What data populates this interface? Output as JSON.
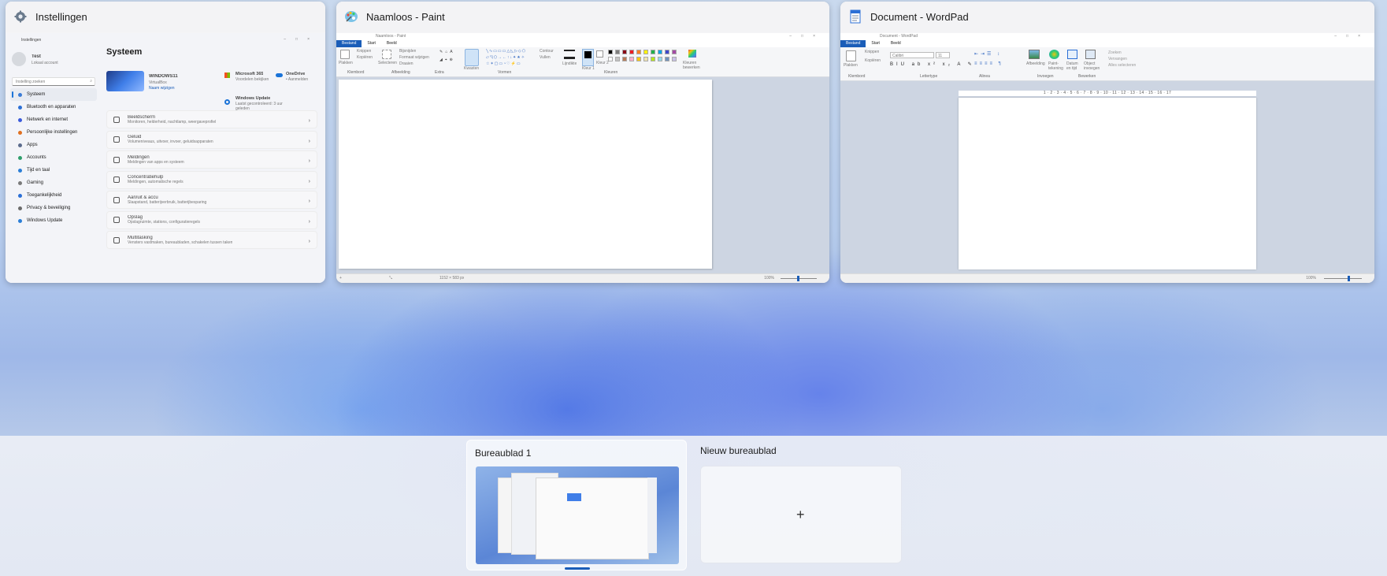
{
  "windows": {
    "settings": {
      "title": "Instellingen",
      "inner_title": "Instellingen",
      "user_name": "Test",
      "user_account": "Lokaal account",
      "search_placeholder": "Instelling zoeken",
      "page_title": "Systeem",
      "device_name": "WINDOWS11",
      "device_model": "VirtualBox",
      "rename": "Naam wijzigen",
      "ms365": "Microsoft 365",
      "ms365_sub": "Voordelen bekijken",
      "onedrive": "OneDrive",
      "onedrive_sub": "• Aanmelden",
      "wu": "Windows Update",
      "wu_sub1": "Laatst gecontroleerd: 3 uur",
      "wu_sub2": "geleden",
      "sidebar": [
        {
          "label": "Systeem",
          "color": "#3a7bd5"
        },
        {
          "label": "Bluetooth en apparaten",
          "color": "#2b6fd6"
        },
        {
          "label": "Netwerk en internet",
          "color": "#3b5bdb"
        },
        {
          "label": "Persoonlijke instellingen",
          "color": "#e07020"
        },
        {
          "label": "Apps",
          "color": "#5b6b8c"
        },
        {
          "label": "Accounts",
          "color": "#2e9e6b"
        },
        {
          "label": "Tijd en taal",
          "color": "#2b7ed6"
        },
        {
          "label": "Gaming",
          "color": "#7a7a7a"
        },
        {
          "label": "Toegankelijkheid",
          "color": "#2b6fd6"
        },
        {
          "label": "Privacy & beveiliging",
          "color": "#6b6b6b"
        },
        {
          "label": "Windows Update",
          "color": "#2b7ed6"
        }
      ],
      "rows": [
        {
          "title": "Beeldscherm",
          "sub": "Monitoren, helderheid, nachtlamp, weergaveprofiel"
        },
        {
          "title": "Geluid",
          "sub": "Volumeniveaus, uitvoer, invoer, geluidsapparaten"
        },
        {
          "title": "Meldingen",
          "sub": "Meldingen van apps en systeem"
        },
        {
          "title": "Concentratiehulp",
          "sub": "Meldingen, automatische regels"
        },
        {
          "title": "Aan/uit & accu",
          "sub": "Slaapstand, batterijverbruik, batterijbesparing"
        },
        {
          "title": "Opslag",
          "sub": "Opslagruimte, stations, configuratieregels"
        },
        {
          "title": "Multitasking",
          "sub": "Vensters vastmaken, bureaubladen, schakelen tussen taken"
        }
      ]
    },
    "paint": {
      "title": "Naamloos - Paint",
      "inner_title": "Naamloos - Paint",
      "tabs": [
        "Bestand",
        "Start",
        "Beeld"
      ],
      "groups": [
        "Klembord",
        "Afbeelding",
        "Extra",
        "Vormen",
        "Kleuren"
      ],
      "paste": "Plakken",
      "select": "Selecteren",
      "crop": "Bijsnijden",
      "resize": "Formaat wijzigen",
      "rotate": "Draaien",
      "brushes": "Kwasten",
      "outline": "Contour",
      "fill": "Vullen",
      "size": "Lijndikte",
      "color1": "Kleur 1",
      "color2": "Kleur 2",
      "edit_colors": "Kleuren bewerken",
      "canvas_size": "1152 × 583 px",
      "zoom": "100%",
      "palette": [
        "#000000",
        "#7f7f7f",
        "#880015",
        "#ed1c24",
        "#ff7f27",
        "#fff200",
        "#22b14c",
        "#00a2e8",
        "#3f48cc",
        "#a349a4",
        "#ffffff",
        "#c3c3c3",
        "#b97a57",
        "#ffaec9",
        "#ffc90e",
        "#efe4b0",
        "#b5e61d",
        "#99d9ea",
        "#7092be",
        "#c8bfe7"
      ]
    },
    "wordpad": {
      "title": "Document - WordPad",
      "inner_title": "Document - WordPad",
      "tabs": [
        "Bestand",
        "Start",
        "Beeld"
      ],
      "groups": [
        "Klembord",
        "Lettertype",
        "Alinea",
        "Invoegen",
        "Bewerken"
      ],
      "paste": "Plakken",
      "cut": "Knippen",
      "copy": "Kopiëren",
      "font": "Calibri",
      "font_size": "11",
      "picture": "Afbeelding",
      "paint_drawing": "Paint-tekening",
      "date_time": "Datum en tijd",
      "insert_object": "Object invoegen",
      "find": "Zoeken",
      "replace": "Vervangen",
      "select_all": "Alles selecteren",
      "zoom": "100%",
      "ruler": "1 · 2 · 3 · 4 · 5 · 6 · 7 · 8 · 9 · 10 · 11 · 12 · 13 · 14 · 15 · 16 · 17"
    }
  },
  "desktops": {
    "current": "Bureaublad 1",
    "new": "Nieuw bureaublad",
    "plus_glyph": "+"
  }
}
